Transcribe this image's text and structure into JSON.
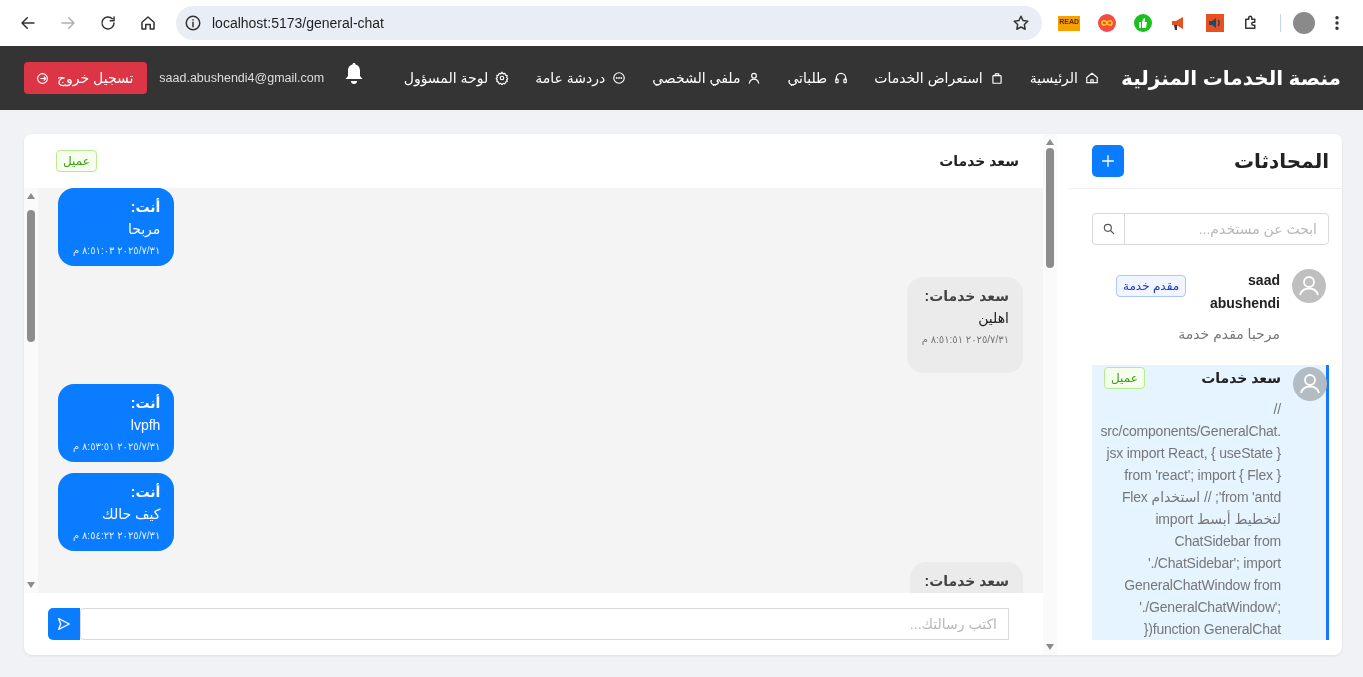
{
  "browser": {
    "url": "localhost:5173/general-chat",
    "extensions": [
      {
        "kind": "read",
        "label": "READ"
      },
      {
        "kind": "infinity"
      },
      {
        "kind": "thumb"
      },
      {
        "kind": "megaphone"
      },
      {
        "kind": "speaker"
      },
      {
        "kind": "puzzle"
      }
    ]
  },
  "nav": {
    "brand": "منصة الخدمات المنزلية",
    "items": [
      {
        "label": "الرئيسية",
        "kind": "home"
      },
      {
        "label": "استعراض الخدمات",
        "kind": "services"
      },
      {
        "label": "طلباتي",
        "kind": "orders"
      },
      {
        "label": "ملفي الشخصي",
        "kind": "profile"
      },
      {
        "label": "دردشة عامة",
        "kind": "chat"
      },
      {
        "label": "لوحة المسؤول",
        "kind": "admin"
      }
    ],
    "email": "saad.abushendi4@gmail.com",
    "logout": "تسجيل خروج"
  },
  "chat": {
    "title": "سعد خدمات",
    "role": {
      "label": "عميل",
      "kind": "client"
    },
    "messages": [
      {
        "kind": "sent",
        "sender": "أنت:",
        "text": "مربحا",
        "time": "٢٠٢٥/٧/٣١ ٨:٥١:٠٣ م"
      },
      {
        "kind": "received",
        "sender": "سعد خدمات:",
        "text": "اهلين",
        "time": "٢٠٢٥/٧/٣١ ٨:٥١:٥١ م"
      },
      {
        "kind": "sent",
        "sender": "أنت:",
        "text": "lvpfh",
        "time": "٢٠٢٥/٧/٣١ ٨:٥٣:٥١ م"
      },
      {
        "kind": "sent",
        "sender": "أنت:",
        "text": "كيف حالك",
        "time": "٢٠٢٥/٧/٣١ ٨:٥٤:٢٢ م"
      },
      {
        "kind": "received",
        "sender": "سعد خدمات:"
      }
    ],
    "input_placeholder": "اكتب رسالتك..."
  },
  "sidebar": {
    "title": "المحادثات",
    "search_placeholder": "ابحث عن مستخدم...",
    "conversations": [
      {
        "name": "saad abushendi",
        "role": {
          "label": "مقدم خدمة",
          "kind": "provider"
        },
        "preview": "مرحبا مقدم خدمة",
        "selected": false
      },
      {
        "name": "سعد خدمات",
        "role": {
          "label": "عميل",
          "kind": "client"
        },
        "preview": "// src/components/GeneralChat.jsx import React, { useState } from 'react'; import { Flex } from 'antd'; // استخدام Flex لتخطيط أبسط import ChatSidebar from './ChatSidebar'; import GeneralChatWindow from './GeneralChatWindow'; function GeneralChat({",
        "selected": true
      }
    ]
  }
}
